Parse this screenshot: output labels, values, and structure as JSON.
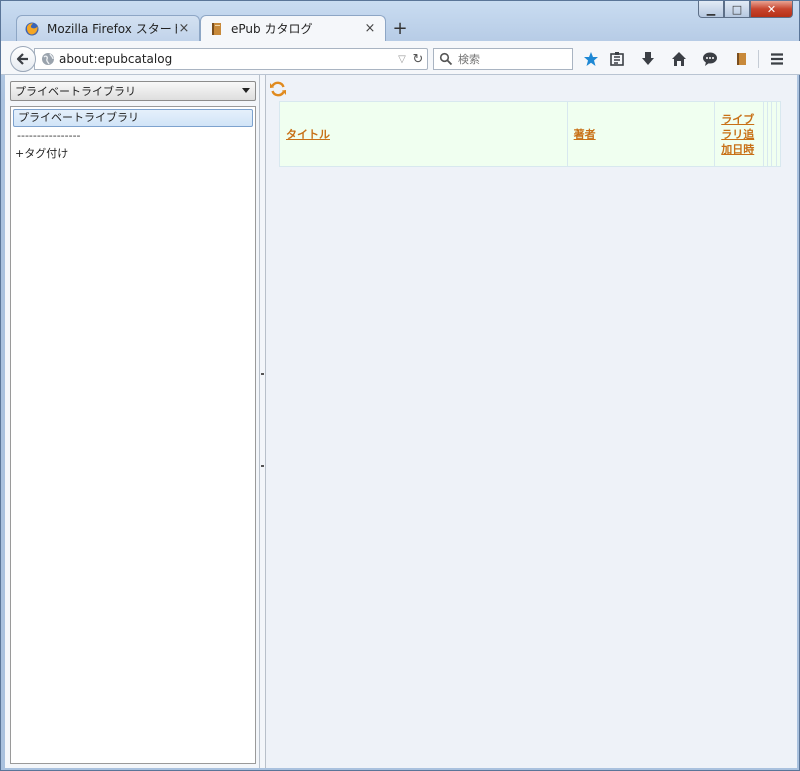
{
  "tabs": [
    {
      "label": "Mozilla Firefox スタート...",
      "close": "×"
    },
    {
      "label": "ePub カタログ",
      "close": "×"
    }
  ],
  "new_tab": "+",
  "url": "about:epubcatalog",
  "search": {
    "placeholder": "検索"
  },
  "sidebar": {
    "select_value": "プライベートライブラリ",
    "items": [
      {
        "label": "プライベートライブラリ"
      },
      {
        "label": "----------------"
      },
      {
        "label": "+タグ付け"
      }
    ]
  },
  "table": {
    "headers": [
      "タイトル",
      "著者",
      "ライブラリ追加日時"
    ]
  },
  "colors": {
    "accent": "#c87016",
    "table_bg": "#f0fff0",
    "bookmark_star": "#1e88d4"
  }
}
